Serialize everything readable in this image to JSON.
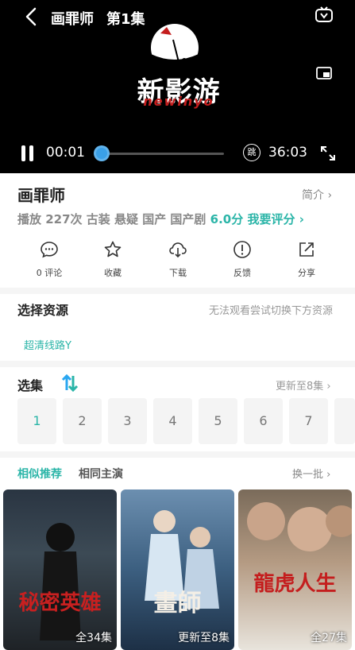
{
  "player": {
    "title": "画罪师",
    "episode": "第1集",
    "logo_title": "新影游",
    "logo_subtitle": "newinyo",
    "time_current": "00:01",
    "time_total": "36:03",
    "skip_label": "跳",
    "progress": 0.01
  },
  "info": {
    "title": "画罪师",
    "intro": "简介 ›",
    "meta": "播放 227次  古装 悬疑 国产 国产剧",
    "score": "6.0分",
    "rate": "我要评分 ›"
  },
  "actions": [
    {
      "label": "0 评论",
      "icon": "comment-icon"
    },
    {
      "label": "收藏",
      "icon": "star-icon"
    },
    {
      "label": "下载",
      "icon": "download-icon"
    },
    {
      "label": "反馈",
      "icon": "feedback-icon"
    },
    {
      "label": "分享",
      "icon": "share-icon"
    }
  ],
  "source": {
    "title": "选择资源",
    "hint": "无法观看尝试切换下方资源",
    "item": "超清线路Y"
  },
  "episodes": {
    "title": "选集",
    "update": "更新至8集 ›",
    "items": [
      "1",
      "2",
      "3",
      "4",
      "5",
      "6",
      "7"
    ]
  },
  "recommend": {
    "tab_similar": "相似推荐",
    "tab_actors": "相同主演",
    "refresh": "换一批 ›",
    "posters": [
      {
        "tag": "全34集",
        "art": "秘密英雄"
      },
      {
        "tag": "更新至8集",
        "art": "畫師"
      },
      {
        "tag": "全27集",
        "art": "龍虎人生"
      }
    ]
  },
  "colors": {
    "accent": "#2bb5a8",
    "progress": "#2aa7f1"
  }
}
